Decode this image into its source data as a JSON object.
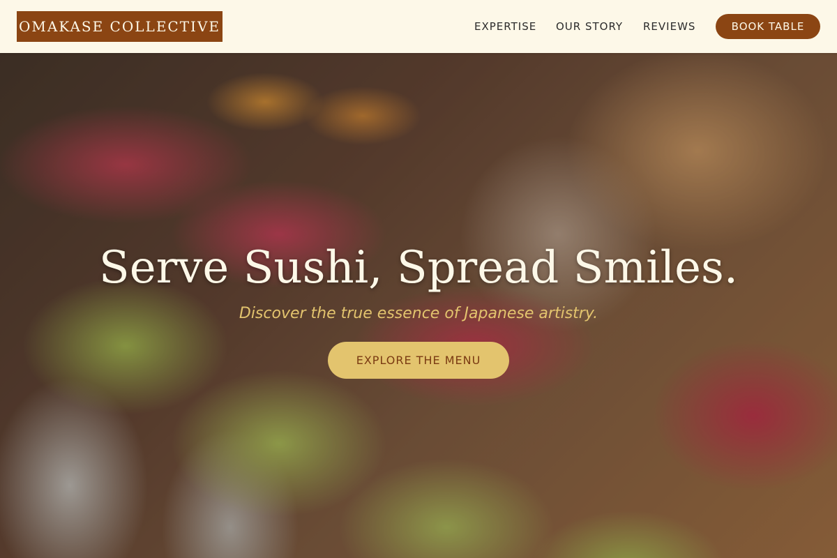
{
  "brand": {
    "logo_text": "OMAKASE COLLECTIVE"
  },
  "nav": {
    "items": [
      {
        "label": "EXPERTISE"
      },
      {
        "label": "OUR STORY"
      },
      {
        "label": "REVIEWS"
      }
    ],
    "book_label": "BOOK TABLE"
  },
  "hero": {
    "title": "Serve Sushi, Spread Smiles.",
    "subtitle": "Discover the true essence of Japanese artistry.",
    "cta_label": "EXPLORE THE MENU",
    "background_image": "sushi rolls with tuna and avocado"
  },
  "colors": {
    "header_bg": "#FDF8E8",
    "brand": "#8B4513",
    "accent_gold": "#E3C46E",
    "cta_text": "#7A3A12"
  }
}
